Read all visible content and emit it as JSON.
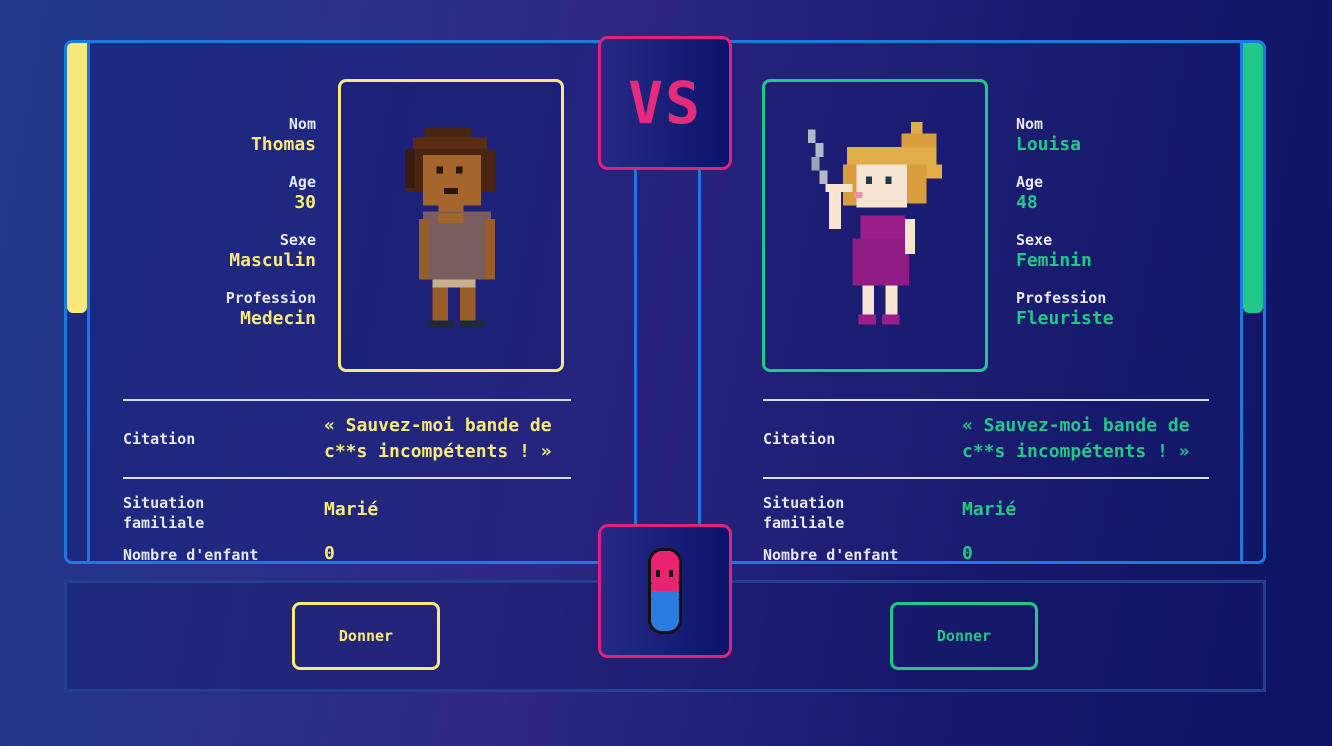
{
  "vs_label": "VS",
  "fields": {
    "name": "Nom",
    "age": "Age",
    "sex": "Sexe",
    "profession": "Profession",
    "quote": "Citation",
    "family": "Situation familiale",
    "children": "Nombre d'enfant"
  },
  "left": {
    "name": "Thomas",
    "age": "30",
    "sex": "Masculin",
    "profession": "Medecin",
    "quote": "« Sauvez-moi bande de c**s incompétents ! »",
    "family": "Marié",
    "children": "0",
    "button": "Donner",
    "accent_color": "#f7ea7b"
  },
  "right": {
    "name": "Louisa",
    "age": "48",
    "sex": "Feminin",
    "profession": "Fleuriste",
    "quote": "« Sauvez-moi bande de c**s incompétents ! »",
    "family": "Marié",
    "children": "0",
    "button": "Donner",
    "accent_color": "#22c887"
  },
  "colors": {
    "frame_border": "#1f78e0",
    "vs_pink": "#e52b7b",
    "pill_top": "#e8236f",
    "pill_bottom": "#2a7de0"
  },
  "icons": {
    "left_portrait": "pixel-man-doctor-icon",
    "right_portrait": "pixel-woman-smoking-icon",
    "center": "pill-icon"
  }
}
